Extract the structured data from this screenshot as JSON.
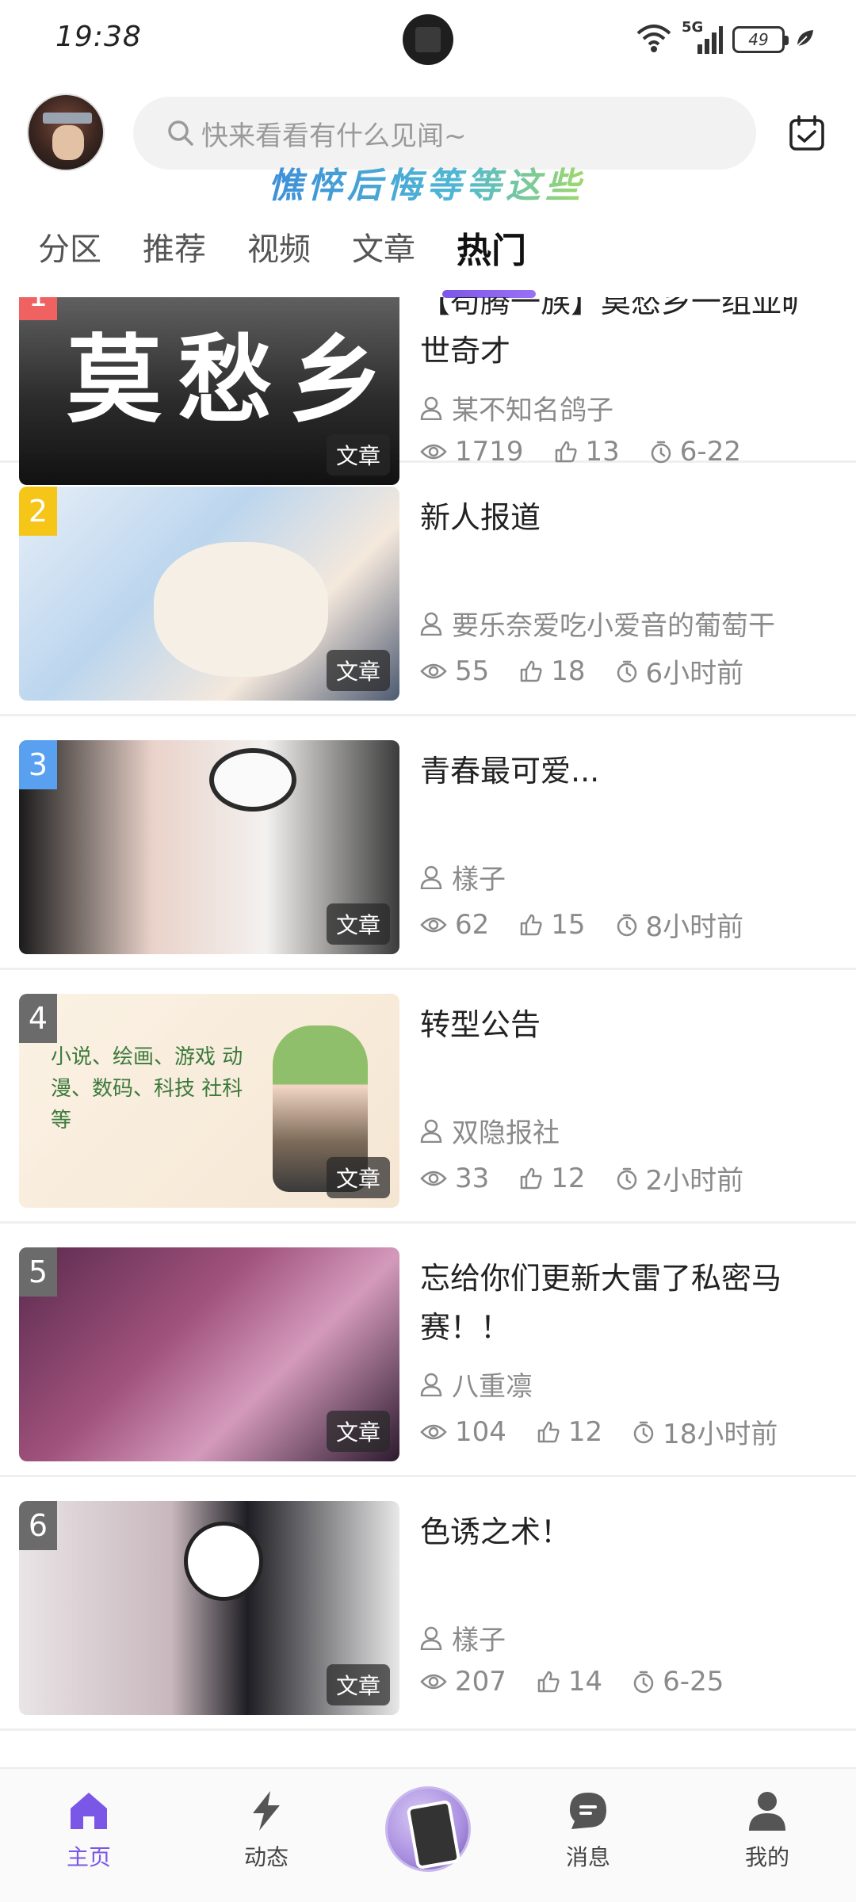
{
  "status_bar": {
    "time": "19:38",
    "network": "5G",
    "battery": "49"
  },
  "header": {
    "search_placeholder": "快来看看有什么见闻~",
    "slogan": "憔悴后悔等等这些"
  },
  "tabs": [
    {
      "label": "分区",
      "active": false
    },
    {
      "label": "推荐",
      "active": false
    },
    {
      "label": "视频",
      "active": false
    },
    {
      "label": "文章",
      "active": false
    },
    {
      "label": "热门",
      "active": true
    }
  ],
  "colors": {
    "accent": "#7b57e8",
    "rank_1": "#f06161",
    "rank_2": "#f5c518",
    "rank_3": "#5aa0f0",
    "rank_other": "#6b6b6b"
  },
  "posts": [
    {
      "rank": "1",
      "title_lines": "【苟腾一族】莫愁乡一组亚旷世奇才",
      "tag": "文章",
      "art_text": "莫愁乡",
      "author": "某不知名鸽子",
      "views": "1719",
      "likes": "13",
      "time": "6-22"
    },
    {
      "rank": "2",
      "title_lines": "新人报道",
      "tag": "文章",
      "author": "要乐奈爱吃小爱音的葡萄干",
      "views": "55",
      "likes": "18",
      "time": "6小时前"
    },
    {
      "rank": "3",
      "title_lines": "青春最可爱...",
      "tag": "文章",
      "author": "樣子",
      "views": "62",
      "likes": "15",
      "time": "8小时前"
    },
    {
      "rank": "4",
      "title_lines": "转型公告",
      "tag": "文章",
      "art_text": "小说、绘画、游戏 动漫、数码、科技 社科等",
      "author": "双隐报社",
      "views": "33",
      "likes": "12",
      "time": "2小时前"
    },
    {
      "rank": "5",
      "title_lines": "忘给你们更新大雷了私密马赛！！",
      "tag": "文章",
      "author": "八重凛",
      "views": "104",
      "likes": "12",
      "time": "18小时前"
    },
    {
      "rank": "6",
      "title_lines": "色诱之术！",
      "tag": "文章",
      "author": "樣子",
      "views": "207",
      "likes": "14",
      "time": "6-25"
    }
  ],
  "bottom_nav": {
    "home": "主页",
    "feed": "动态",
    "messages": "消息",
    "mine": "我的",
    "icons": [
      "home-icon",
      "lightning-icon",
      "center-post-icon",
      "chat-icon",
      "person-icon"
    ]
  }
}
